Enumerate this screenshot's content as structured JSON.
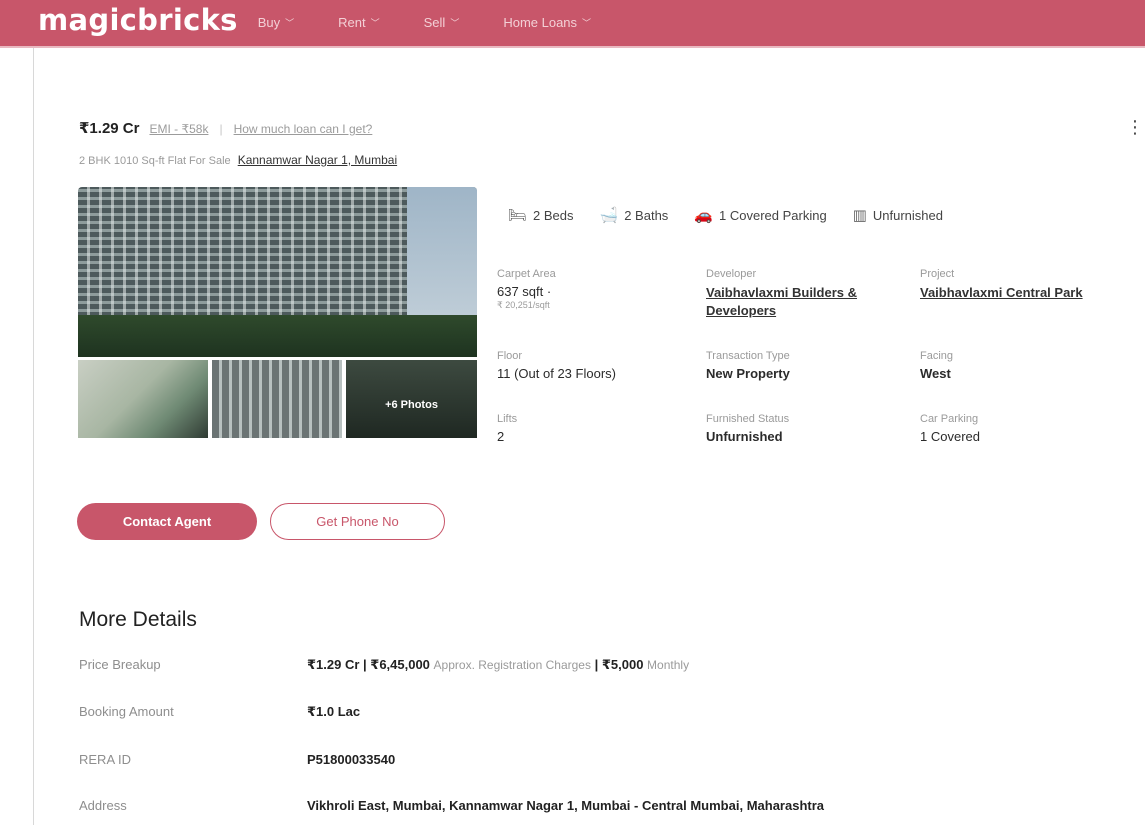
{
  "header": {
    "logo": "magicbricks",
    "nav": [
      {
        "label": "Buy"
      },
      {
        "label": "Rent"
      },
      {
        "label": "Sell"
      },
      {
        "label": "Home Loans"
      }
    ]
  },
  "listing": {
    "price": "₹1.29 Cr",
    "emi": "EMI - ₹58k",
    "separator": "|",
    "loan_link": "How much loan can I get?",
    "subtitle": "2 BHK 1010 Sq-ft Flat For Sale",
    "location": "Kannamwar Nagar 1, Mumbai",
    "more_photos": "+6 Photos",
    "amenities": [
      {
        "icon": "bed-icon",
        "label": "2 Beds"
      },
      {
        "icon": "bath-icon",
        "label": "2 Baths"
      },
      {
        "icon": "car-icon",
        "label": "1 Covered Parking"
      },
      {
        "icon": "furniture-icon",
        "label": "Unfurnished"
      }
    ],
    "details": {
      "carpet_area": {
        "label": "Carpet Area",
        "value": "637 sqft ·",
        "sub": "₹ 20,251/sqft"
      },
      "developer": {
        "label": "Developer",
        "value": "Vaibhavlaxmi Builders & Developers"
      },
      "project": {
        "label": "Project",
        "value": "Vaibhavlaxmi Central Park"
      },
      "floor": {
        "label": "Floor",
        "value": "11 (Out of 23 Floors)"
      },
      "transaction": {
        "label": "Transaction Type",
        "value": "New Property"
      },
      "facing": {
        "label": "Facing",
        "value": "West"
      },
      "lifts": {
        "label": "Lifts",
        "value": "2"
      },
      "furnished": {
        "label": "Furnished Status",
        "value": "Unfurnished"
      },
      "car_parking": {
        "label": "Car Parking",
        "value": "1 Covered"
      }
    },
    "buttons": {
      "contact": "Contact Agent",
      "phone": "Get Phone No"
    }
  },
  "more_details": {
    "title": "More Details",
    "price_breakup": {
      "label": "Price Breakup",
      "price": "₹1.29 Cr | ₹6,45,000",
      "reg_note": "Approx. Registration Charges",
      "sep": " | ",
      "monthly": "₹5,000",
      "monthly_note": "Monthly"
    },
    "booking": {
      "label": "Booking Amount",
      "value": "₹1.0 Lac"
    },
    "rera": {
      "label": "RERA ID",
      "value": "P51800033540"
    },
    "address": {
      "label": "Address",
      "value": "Vikhroli East, Mumbai, Kannamwar Nagar 1, Mumbai - Central Mumbai, Maharashtra"
    }
  }
}
